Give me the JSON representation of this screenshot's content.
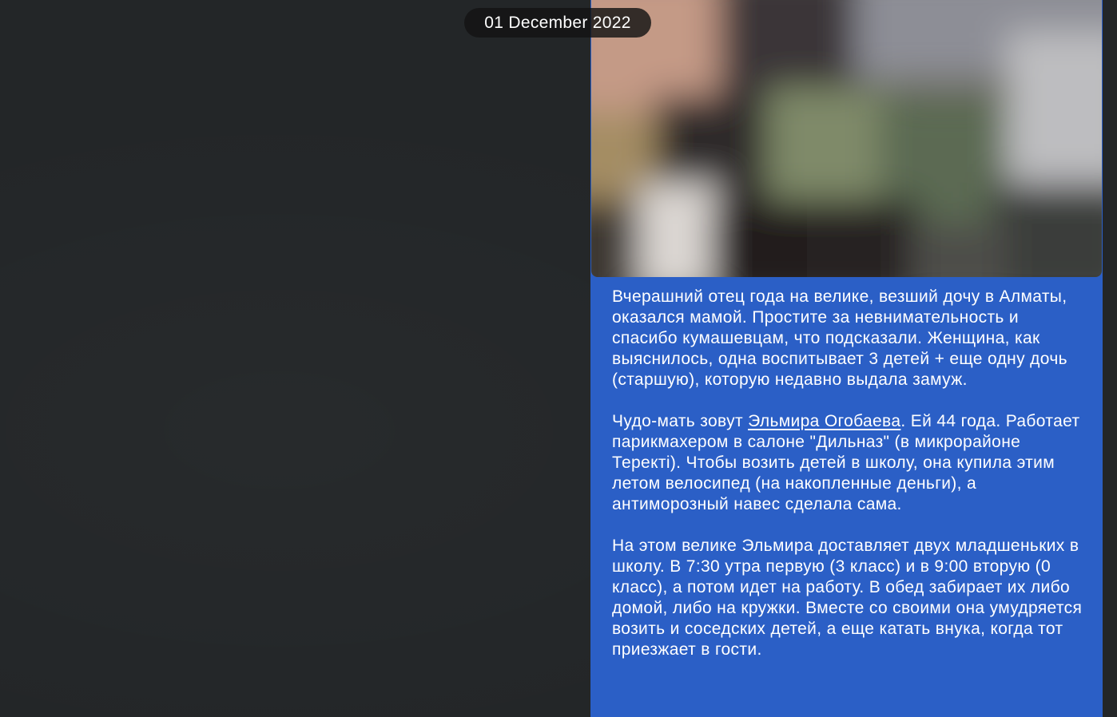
{
  "date_separator": "01 December 2022",
  "message": {
    "photo_icon": "blurred-photo",
    "paragraphs": {
      "p1": "Вчерашний отец года на велике, везший дочу в Алматы, оказался мамой. Простите за невнимательность и спасибо кумашевцам, что подсказали. Женщина, как выяснилось, одна воспитывает 3 детей + еще одну дочь (старшую), которую недавно выдала замуж.",
      "p2_before_link": "Чудо-мать зовут ",
      "p2_link": "Эльмира Огобаева",
      "p2_after_link": ". Ей 44 года. Работает парикмахером в салоне \"Дильназ\" (в микрорайоне Теректі). Чтобы возить детей в школу, она купила этим летом велосипед (на накопленные деньги), а антиморозный навес сделала сама.",
      "p3": "На этом велике Эльмира доставляет двух младшеньких в школу. В 7:30 утра первую (3 класс) и в 9:00 вторую (0 класс), а потом идет на работу. В обед забирает их либо домой, либо на кружки. Вместе со своими она умудряется возить и соседских детей, а еще катать внука, когда тот приезжает в гости."
    }
  },
  "colors": {
    "chat_background": "#232628",
    "bubble": "#2b5fc6",
    "date_pill": "#141414",
    "text": "#ffffff"
  }
}
